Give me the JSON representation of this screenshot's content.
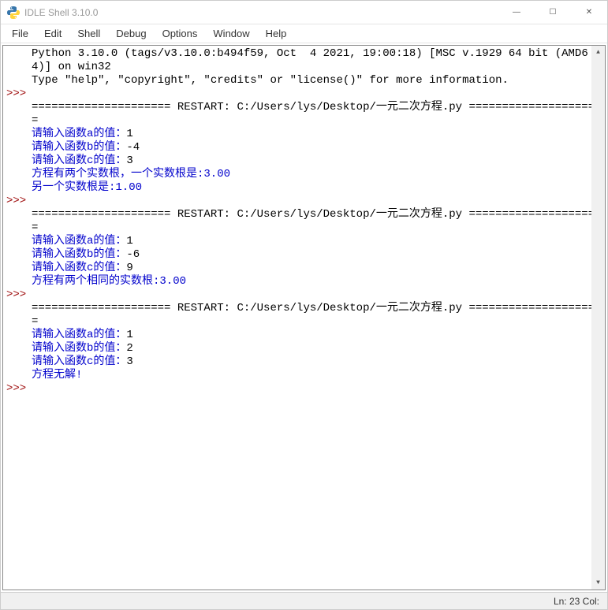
{
  "window": {
    "title": "IDLE Shell 3.10.0"
  },
  "menubar": {
    "items": [
      "File",
      "Edit",
      "Shell",
      "Debug",
      "Options",
      "Window",
      "Help"
    ]
  },
  "banner": {
    "line1": "Python 3.10.0 (tags/v3.10.0:b494f59, Oct  4 2021, 19:00:18) [MSC v.1929 64 bit (AMD64)] on win32",
    "line2": "Type \"help\", \"copyright\", \"credits\" or \"license()\" for more information."
  },
  "sessions": [
    {
      "restart_line": "===================== RESTART: C:/Users/lys/Desktop/一元二次方程.py =====================",
      "io": [
        {
          "prompt": "请输入函数a的值：",
          "input": "1"
        },
        {
          "prompt": "请输入函数b的值：",
          "input": "-4"
        },
        {
          "prompt": "请输入函数c的值：",
          "input": "3"
        }
      ],
      "output": [
        "方程有两个实数根，一个实数根是:3.00",
        "另一个实数根是:1.00"
      ]
    },
    {
      "restart_line": "===================== RESTART: C:/Users/lys/Desktop/一元二次方程.py =====================",
      "io": [
        {
          "prompt": "请输入函数a的值：",
          "input": "1"
        },
        {
          "prompt": "请输入函数b的值：",
          "input": "-6"
        },
        {
          "prompt": "请输入函数c的值：",
          "input": "9"
        }
      ],
      "output": [
        "方程有两个相同的实数根:3.00"
      ]
    },
    {
      "restart_line": "===================== RESTART: C:/Users/lys/Desktop/一元二次方程.py =====================",
      "io": [
        {
          "prompt": "请输入函数a的值：",
          "input": "1"
        },
        {
          "prompt": "请输入函数b的值：",
          "input": "2"
        },
        {
          "prompt": "请输入函数c的值：",
          "input": "3"
        }
      ],
      "output": [
        "方程无解!"
      ]
    }
  ],
  "status": {
    "text": "Ln: 23  Col:"
  },
  "glyphs": {
    "prompt": ">>>",
    "min": "—",
    "max": "☐",
    "close": "✕",
    "up": "▲",
    "down": "▼"
  }
}
